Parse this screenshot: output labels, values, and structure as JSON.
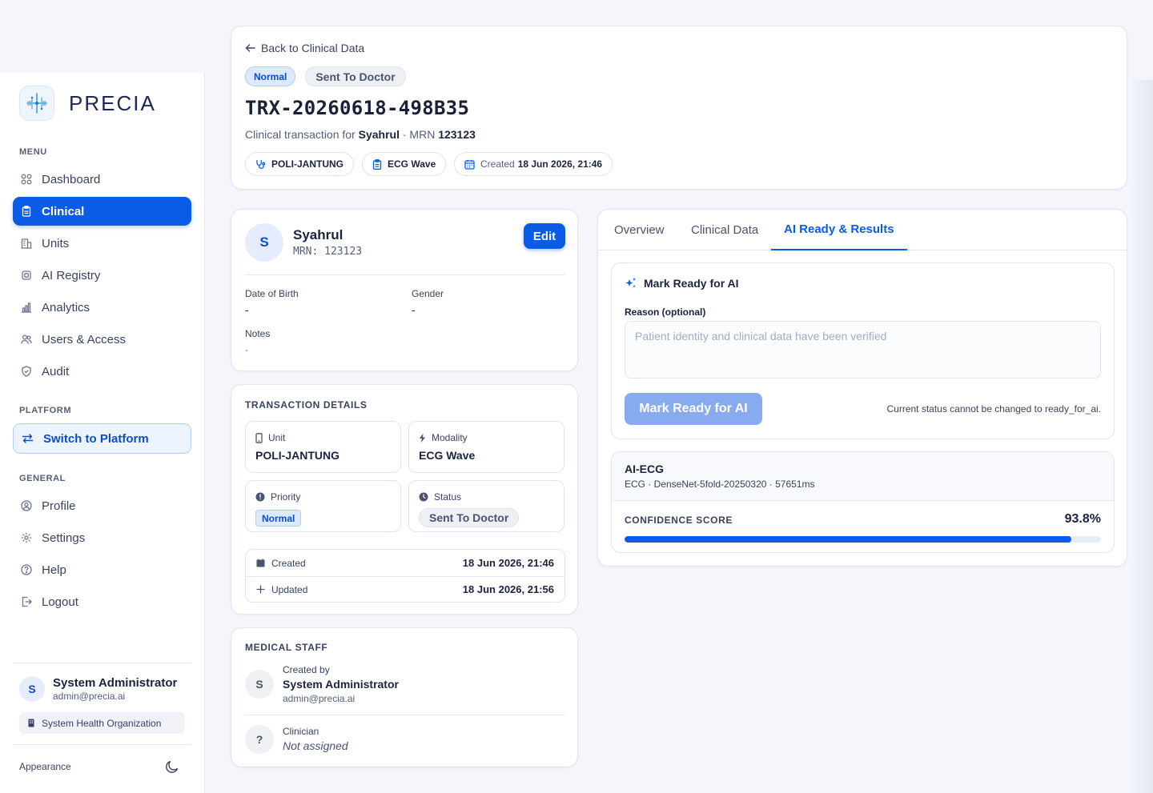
{
  "brand": {
    "name": "PRECIA"
  },
  "sidebar": {
    "menu_label": "MENU",
    "menu": [
      {
        "label": "Dashboard",
        "icon": "grid-icon"
      },
      {
        "label": "Clinical",
        "icon": "clipboard-icon",
        "active": true
      },
      {
        "label": "Units",
        "icon": "building-icon"
      },
      {
        "label": "AI Registry",
        "icon": "chip-icon"
      },
      {
        "label": "Analytics",
        "icon": "bar-chart-icon"
      },
      {
        "label": "Users & Access",
        "icon": "users-icon"
      },
      {
        "label": "Audit",
        "icon": "shield-icon"
      }
    ],
    "platform_label": "PLATFORM",
    "switch_label": "Switch to Platform",
    "general_label": "GENERAL",
    "general": [
      {
        "label": "Profile",
        "icon": "user-circle-icon"
      },
      {
        "label": "Settings",
        "icon": "gear-icon"
      },
      {
        "label": "Help",
        "icon": "help-circle-icon"
      },
      {
        "label": "Logout",
        "icon": "logout-icon"
      }
    ],
    "user": {
      "initial": "S",
      "name": "System Administrator",
      "email": "admin@precia.ai"
    },
    "org": "System Health Organization",
    "appearance_label": "Appearance"
  },
  "header": {
    "back_label": "Back to Clinical Data",
    "priority_badge": "Normal",
    "status_badge": "Sent To Doctor",
    "title": "TRX-20260618-498B35",
    "sub_prefix": "Clinical transaction for",
    "patient_name": "Syahrul",
    "mrn_label": "· MRN",
    "mrn": "123123",
    "pills": {
      "unit": "POLI-JANTUNG",
      "modality": "ECG Wave",
      "created_label": "Created",
      "created_value": "18 Jun 2026, 21:46"
    }
  },
  "patient": {
    "initial": "S",
    "name": "Syahrul",
    "mrn": "MRN: 123123",
    "edit_label": "Edit",
    "dob_label": "Date of Birth",
    "dob": "-",
    "gender_label": "Gender",
    "gender": "-",
    "notes_label": "Notes",
    "notes": "-"
  },
  "transaction": {
    "heading": "TRANSACTION DETAILS",
    "unit_label": "Unit",
    "unit": "POLI-JANTUNG",
    "modality_label": "Modality",
    "modality": "ECG Wave",
    "priority_label": "Priority",
    "priority": "Normal",
    "status_label": "Status",
    "status": "Sent To Doctor",
    "created_label": "Created",
    "created": "18 Jun 2026, 21:46",
    "updated_label": "Updated",
    "updated": "18 Jun 2026, 21:56"
  },
  "staff": {
    "heading": "MEDICAL STAFF",
    "created_by_label": "Created by",
    "creator_initial": "S",
    "creator_name": "System Administrator",
    "creator_email": "admin@precia.ai",
    "clinician_label": "Clinician",
    "clinician_initial": "?",
    "clinician_value": "Not assigned"
  },
  "tabs": [
    {
      "label": "Overview"
    },
    {
      "label": "Clinical Data"
    },
    {
      "label": "AI Ready & Results",
      "active": true
    }
  ],
  "ai_ready": {
    "title": "Mark Ready for AI",
    "reason_label": "Reason (optional)",
    "reason_placeholder": "Patient identity and clinical data have been verified",
    "button_label": "Mark Ready for AI",
    "note": "Current status cannot be changed to ready_for_ai."
  },
  "ai_result": {
    "title": "AI-ECG",
    "sub": "ECG · DenseNet-5fold-20250320 · 57651ms",
    "confidence_label": "CONFIDENCE SCORE",
    "confidence_text": "93.8%",
    "confidence_value": 0.938
  },
  "colors": {
    "accent": "#0a5ce6",
    "accent_light": "#dce9ff",
    "disabled_button": "#88abf0"
  }
}
